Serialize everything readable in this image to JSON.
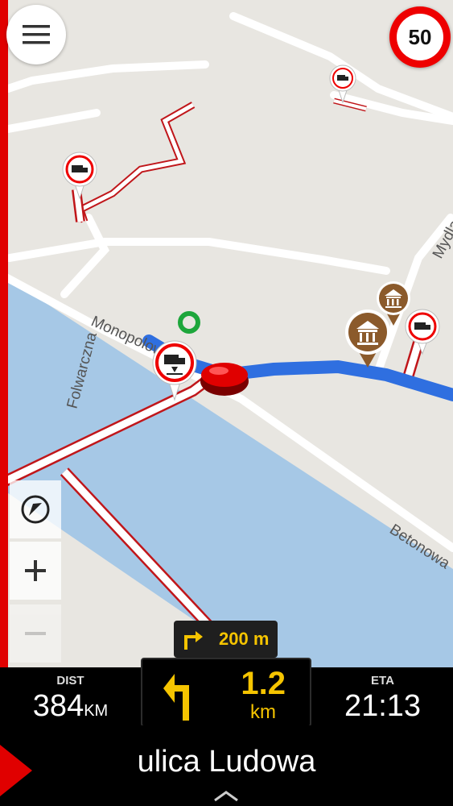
{
  "map": {
    "streets": [
      "Monopolowa",
      "Folwarczna",
      "Mydlarska",
      "Betonowa"
    ],
    "pois": [
      "truck-restriction",
      "truck-restriction",
      "truck-restriction",
      "truck-height-restriction",
      "museum",
      "museum",
      "destination-flag"
    ]
  },
  "speed_limit": "50",
  "next_turn": {
    "distance": "200 m",
    "icon": "turn-right-icon"
  },
  "dist": {
    "label": "DIST",
    "value": "384",
    "unit": "KM"
  },
  "maneuver": {
    "value": "1.2",
    "unit": "km",
    "icon": "turn-left-arrow-icon"
  },
  "eta": {
    "label": "ETA",
    "value": "21:13"
  },
  "street": {
    "name": "ulica Ludowa"
  },
  "colors": {
    "route": "#2f6fe0",
    "restricted": "#c0161a",
    "water": "#a7cbe8",
    "accent": "#f5c400",
    "marker": "#e00000"
  }
}
